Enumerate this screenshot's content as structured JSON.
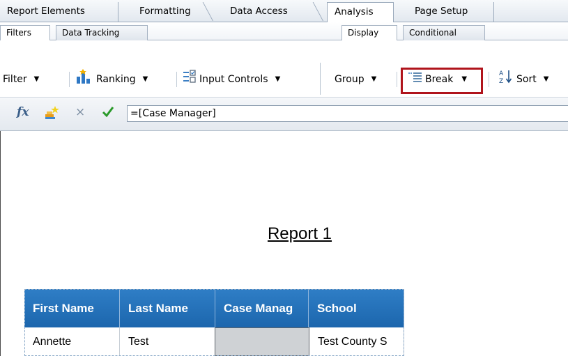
{
  "tabs": [
    {
      "label": "Report Elements"
    },
    {
      "label": "Formatting"
    },
    {
      "label": "Data Access"
    },
    {
      "label": "Analysis"
    },
    {
      "label": "Page Setup"
    }
  ],
  "active_tab": "Analysis",
  "subtabs": {
    "left": [
      {
        "label": "Filters"
      },
      {
        "label": "Data Tracking"
      }
    ],
    "right": [
      {
        "label": "Display"
      },
      {
        "label": "Conditional"
      }
    ]
  },
  "toolbar": {
    "filter": "Filter",
    "ranking": "Ranking",
    "input_controls": "Input Controls",
    "group": "Group",
    "break": "Break",
    "sort": "Sort"
  },
  "formula": {
    "fx": "fx",
    "value": "=[Case Manager]"
  },
  "report": {
    "title": "Report 1",
    "columns": [
      "First Name",
      "Last Name",
      "Case Manag",
      "School"
    ],
    "rows": [
      [
        "Annette",
        "Test",
        "",
        "Test County S"
      ]
    ]
  },
  "colors": {
    "header_blue": "#1f6db5",
    "highlight_red": "#b0141c",
    "checkmark_green": "#2a9a2a"
  },
  "icons": [
    "dropdown-arrow-icon",
    "ranking-icon",
    "input-controls-icon",
    "break-icon",
    "sort-az-icon",
    "fx-icon",
    "variable-editor-icon",
    "cancel-x-icon",
    "validate-check-icon"
  ]
}
